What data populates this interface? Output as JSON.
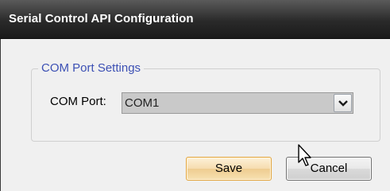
{
  "window": {
    "title": "Serial Control API Configuration"
  },
  "com_settings": {
    "legend": "COM Port Settings",
    "com_port_label": "COM Port:",
    "com_port_value": "COM1"
  },
  "buttons": {
    "save_label": "Save",
    "cancel_label": "Cancel"
  },
  "icons": {
    "dropdown": "chevron-down-icon",
    "cursor": "mouse-pointer-icon"
  },
  "colors": {
    "titlebar": "#2a2a2a",
    "legend_text": "#3c50b4",
    "save_border": "#e3a640"
  }
}
